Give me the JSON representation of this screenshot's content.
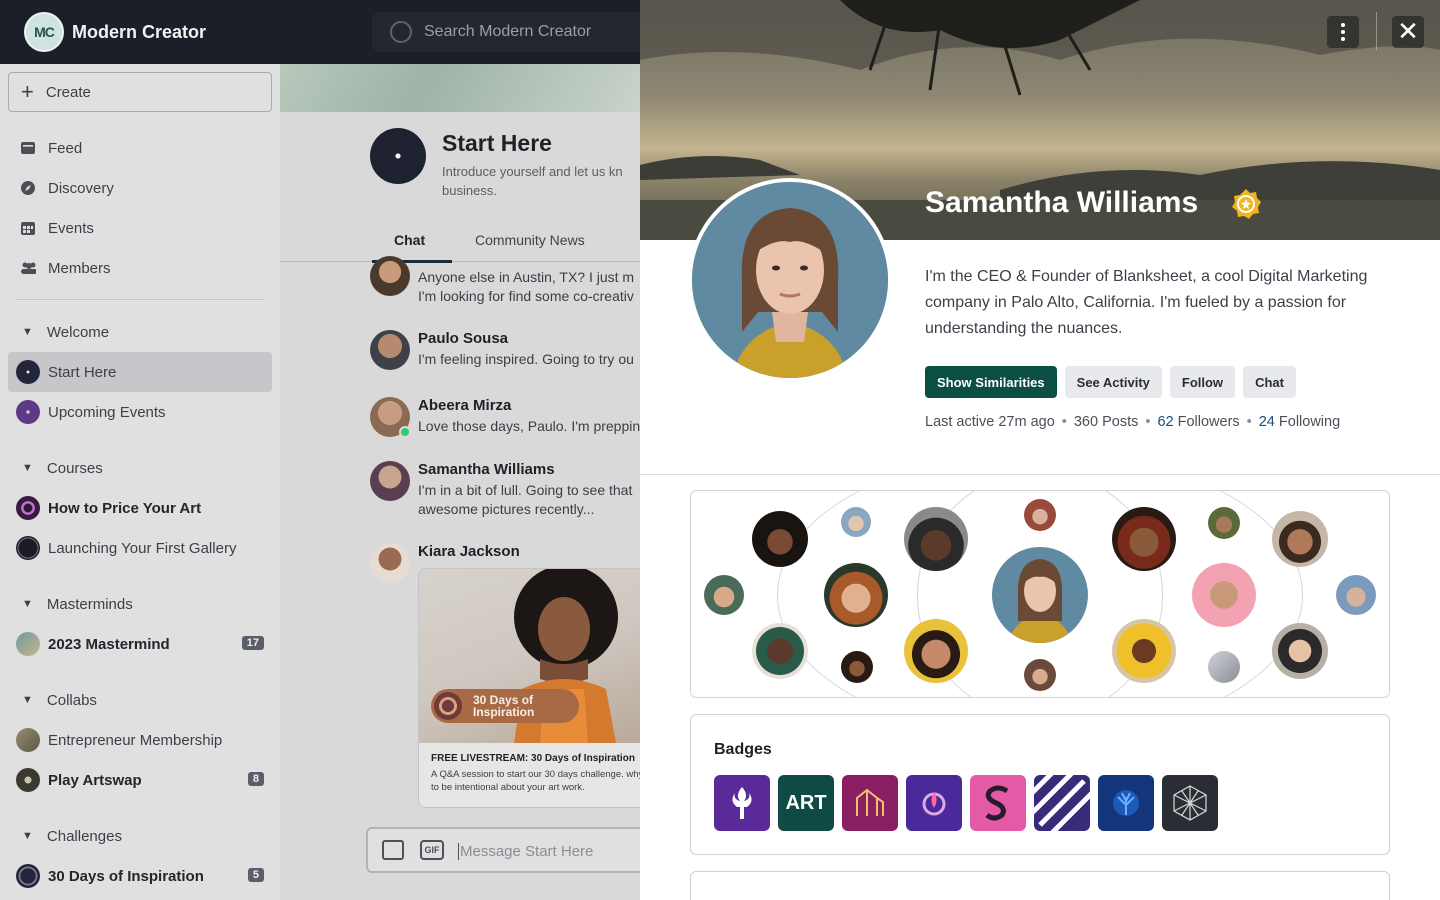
{
  "app": {
    "brand_initials": "MC",
    "brand_name": "Modern Creator",
    "search_placeholder": "Search Modern Creator"
  },
  "sidebar": {
    "create_label": "Create",
    "nav": [
      {
        "label": "Feed",
        "icon": "feed-icon"
      },
      {
        "label": "Discovery",
        "icon": "compass-icon"
      },
      {
        "label": "Events",
        "icon": "calendar-icon"
      },
      {
        "label": "Members",
        "icon": "members-icon"
      }
    ],
    "sections": {
      "welcome": "Welcome",
      "courses": "Courses",
      "masterminds": "Masterminds",
      "collabs": "Collabs",
      "challenges": "Challenges"
    },
    "spaces": {
      "start_here": "Start Here",
      "upcoming_events": "Upcoming Events",
      "price_art": "How to Price Your Art",
      "first_gallery": "Launching Your First Gallery",
      "mastermind": "2023 Mastermind",
      "mastermind_count": "17",
      "entrepreneur": "Entrepreneur Membership",
      "artswap": "Play Artswap",
      "artswap_count": "8",
      "thirty_days": "30 Days of Inspiration",
      "thirty_days_count": "5"
    }
  },
  "space": {
    "title": "Start Here",
    "description_line1": "Introduce yourself and let us kn",
    "description_line2": "business.",
    "tabs": [
      "Chat",
      "Community News"
    ],
    "messages": [
      {
        "name": "Paulo Sousa",
        "text": "I'm feeling inspired. Going to try ou"
      },
      {
        "name": "Abeera Mirza",
        "text": "Love those days, Paulo. I'm preppin"
      },
      {
        "name": "Samantha Williams",
        "text1": "I'm in a bit of lull. Going to see that",
        "text2": "awesome pictures recently..."
      },
      {
        "name": "Kiara Jackson"
      }
    ],
    "partial_message_line1": "Anyone else in Austin, TX? I just m",
    "partial_message_line2": "I'm looking for find some co-creativ",
    "card": {
      "pill": "30 Days of Inspiration",
      "title": "FREE LIVESTREAM: 30 Days of Inspiration",
      "description": "A Q&A session to start our 30 days challenge. why to be intentional about your art work."
    },
    "composer_placeholder": "Message Start Here",
    "gif_label": "GIF"
  },
  "profile": {
    "name": "Samantha Williams",
    "bio": "I'm the CEO & Founder of Blanksheet, a cool Digital Marketing company in Palo Alto, California. I'm fueled by a passion for understanding the nuances.",
    "actions": [
      "Show Similarities",
      "See Activity",
      "Follow",
      "Chat"
    ],
    "last_active": "Last active 27m ago",
    "posts": "360 Posts",
    "followers_count": "62",
    "followers_label": "Followers",
    "following_count": "24",
    "following_label": "Following",
    "badges_title": "Badges",
    "badges": [
      {
        "name": "torch-badge",
        "color": "#5b2a9a"
      },
      {
        "name": "art-badge",
        "color": "#0f4a44",
        "text": "ART"
      },
      {
        "name": "m-badge",
        "color": "#8a1e63"
      },
      {
        "name": "rocket-badge",
        "color": "#4a2a9a"
      },
      {
        "name": "s-badge",
        "color": "#e55aa6"
      },
      {
        "name": "stripes-badge",
        "color": "#3a2a7a"
      },
      {
        "name": "coral-badge",
        "color": "#13367a"
      },
      {
        "name": "geo-badge",
        "color": "#2a2d33"
      }
    ]
  },
  "colors": {
    "primary": "#0b4e44",
    "link": "#1a4e7a",
    "topbar": "#1c1f27",
    "verified": "#f2b51f"
  }
}
